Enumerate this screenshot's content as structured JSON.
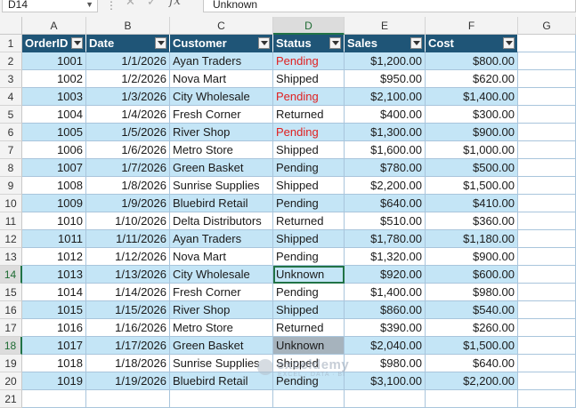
{
  "formula_bar": {
    "name_box": "D14",
    "fx": "fx",
    "cancel_icon": "✕",
    "enter_icon": "✓",
    "value": "Unknown"
  },
  "columns": [
    "A",
    "B",
    "C",
    "D",
    "E",
    "F",
    "G"
  ],
  "selected_column": "D",
  "selected_rows": [
    14,
    18
  ],
  "table": {
    "headers": [
      "OrderID",
      "Date",
      "Customer",
      "Status",
      "Sales",
      "Cost"
    ],
    "rows": [
      {
        "row": 2,
        "id": "1001",
        "date": "1/1/2026",
        "customer": "Ayan Traders",
        "status": "Pending",
        "sales": "$1,200.00",
        "cost": "$800.00"
      },
      {
        "row": 3,
        "id": "1002",
        "date": "1/2/2026",
        "customer": "Nova Mart",
        "status": "Shipped",
        "sales": "$950.00",
        "cost": "$620.00"
      },
      {
        "row": 4,
        "id": "1003",
        "date": "1/3/2026",
        "customer": "City Wholesale",
        "status": "Pending",
        "sales": "$2,100.00",
        "cost": "$1,400.00"
      },
      {
        "row": 5,
        "id": "1004",
        "date": "1/4/2026",
        "customer": "Fresh Corner",
        "status": "Returned",
        "sales": "$400.00",
        "cost": "$300.00"
      },
      {
        "row": 6,
        "id": "1005",
        "date": "1/5/2026",
        "customer": "River Shop",
        "status": "Pending",
        "sales": "$1,300.00",
        "cost": "$900.00"
      },
      {
        "row": 7,
        "id": "1006",
        "date": "1/6/2026",
        "customer": "Metro Store",
        "status": "Shipped",
        "sales": "$1,600.00",
        "cost": "$1,000.00"
      },
      {
        "row": 8,
        "id": "1007",
        "date": "1/7/2026",
        "customer": "Green Basket",
        "status": "Pending",
        "sales": "$780.00",
        "cost": "$500.00"
      },
      {
        "row": 9,
        "id": "1008",
        "date": "1/8/2026",
        "customer": "Sunrise Supplies",
        "status": "Shipped",
        "sales": "$2,200.00",
        "cost": "$1,500.00"
      },
      {
        "row": 10,
        "id": "1009",
        "date": "1/9/2026",
        "customer": "Bluebird Retail",
        "status": "Pending",
        "sales": "$640.00",
        "cost": "$410.00"
      },
      {
        "row": 11,
        "id": "1010",
        "date": "1/10/2026",
        "customer": "Delta Distributors",
        "status": "Returned",
        "sales": "$510.00",
        "cost": "$360.00"
      },
      {
        "row": 12,
        "id": "1011",
        "date": "1/11/2026",
        "customer": "Ayan Traders",
        "status": "Shipped",
        "sales": "$1,780.00",
        "cost": "$1,180.00"
      },
      {
        "row": 13,
        "id": "1012",
        "date": "1/12/2026",
        "customer": "Nova Mart",
        "status": "Pending",
        "sales": "$1,320.00",
        "cost": "$900.00"
      },
      {
        "row": 14,
        "id": "1013",
        "date": "1/13/2026",
        "customer": "City Wholesale",
        "status": "Unknown",
        "sales": "$920.00",
        "cost": "$600.00"
      },
      {
        "row": 15,
        "id": "1014",
        "date": "1/14/2026",
        "customer": "Fresh Corner",
        "status": "Pending",
        "sales": "$1,400.00",
        "cost": "$980.00"
      },
      {
        "row": 16,
        "id": "1015",
        "date": "1/15/2026",
        "customer": "River Shop",
        "status": "Shipped",
        "sales": "$860.00",
        "cost": "$540.00"
      },
      {
        "row": 17,
        "id": "1016",
        "date": "1/16/2026",
        "customer": "Metro Store",
        "status": "Returned",
        "sales": "$390.00",
        "cost": "$260.00"
      },
      {
        "row": 18,
        "id": "1017",
        "date": "1/17/2026",
        "customer": "Green Basket",
        "status": "Unknown",
        "sales": "$2,040.00",
        "cost": "$1,500.00"
      },
      {
        "row": 19,
        "id": "1018",
        "date": "1/18/2026",
        "customer": "Sunrise Supplies",
        "status": "Shipped",
        "sales": "$980.00",
        "cost": "$640.00"
      },
      {
        "row": 20,
        "id": "1019",
        "date": "1/19/2026",
        "customer": "Bluebird Retail",
        "status": "Pending",
        "sales": "$3,100.00",
        "cost": "$2,200.00"
      }
    ],
    "red_status_rows": [
      2,
      4,
      6
    ]
  },
  "watermark": {
    "name": "exceldemy",
    "tagline": "EXCEL · DATA · BI"
  },
  "colors": {
    "header_bg": "#1f5577",
    "band_bg": "#c4e5f6",
    "pending_red": "#e02020",
    "selection_green": "#217346"
  }
}
